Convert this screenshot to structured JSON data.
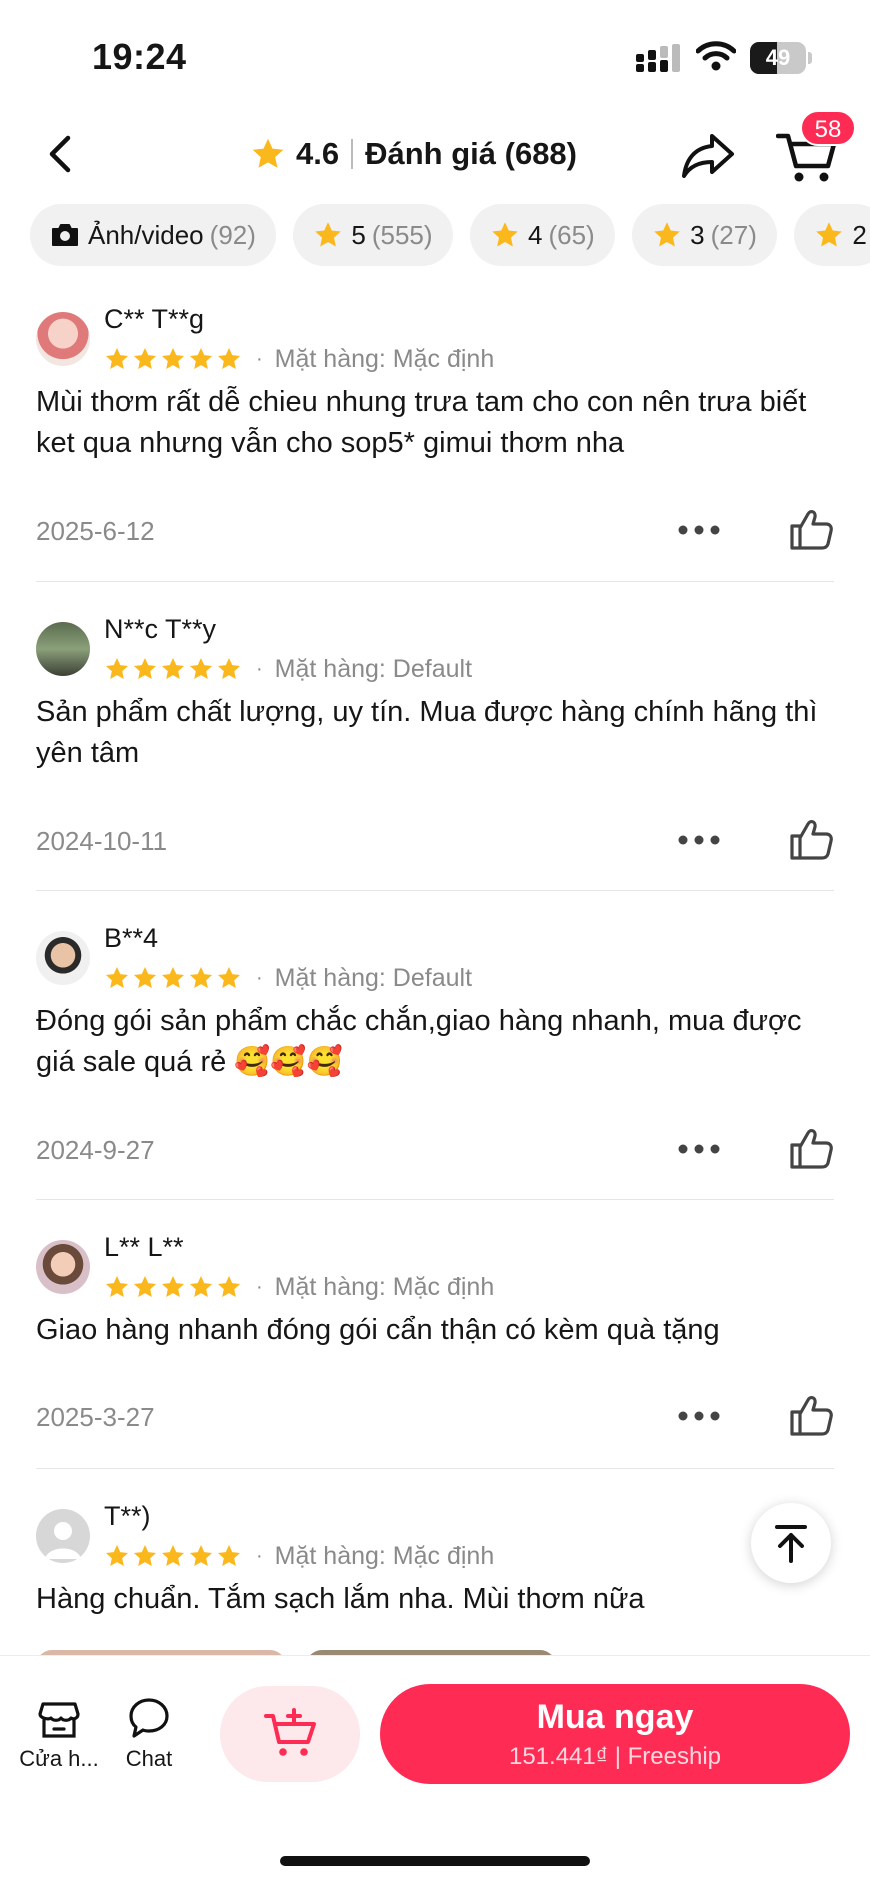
{
  "status_bar": {
    "time": "19:24",
    "battery": "49",
    "battery_level": 0.49
  },
  "header": {
    "rating": "4.6",
    "title": "Đánh giá (688)",
    "cart_badge": "58"
  },
  "filters": [
    {
      "label": "Ảnh/video",
      "count": "(92)",
      "icon": "camera-icon"
    },
    {
      "label": "5",
      "count": "(555)",
      "icon": "star-icon"
    },
    {
      "label": "4",
      "count": "(65)",
      "icon": "star-icon"
    },
    {
      "label": "3",
      "count": "(27)",
      "icon": "star-icon"
    },
    {
      "label": "2",
      "count": "",
      "icon": "star-icon"
    }
  ],
  "reviews": [
    {
      "name": "C** T**g",
      "stars": 5,
      "variant": "Mặt hàng: Mặc định",
      "text": "Mùi thơm rất dễ chieu nhung trưa tam cho con nên trưa biết ket qua nhưng vẫn cho sop5* gimui thơm nha",
      "date": "2025-6-12"
    },
    {
      "name": "N**c T**y",
      "stars": 5,
      "variant": "Mặt hàng: Default",
      "text": "Sản phẩm chất lượng, uy tín. Mua được hàng chính hãng thì yên tâm",
      "date": "2024-10-11"
    },
    {
      "name": "B**4",
      "stars": 5,
      "variant": "Mặt hàng: Default",
      "text": "Đóng gói sản phẩm chắc chắn,giao hàng nhanh, mua được giá sale quá rẻ 🥰🥰🥰",
      "date": "2024-9-27"
    },
    {
      "name": "L** L**",
      "stars": 5,
      "variant": "Mặt hàng: Mặc định",
      "text": "Giao hàng nhanh đóng gói cẩn thận có kèm quà tặng",
      "date": "2025-3-27"
    },
    {
      "name": "T**)",
      "stars": 5,
      "variant": "Mặt hàng: Mặc định",
      "text": "Hàng chuẩn. Tắm sạch lắm nha. Mùi thơm nữa",
      "date": ""
    }
  ],
  "bottom_bar": {
    "shop_label": "Cửa h...",
    "chat_label": "Chat",
    "buy_label": "Mua ngay",
    "buy_sub": "151.441₫ | Freeship"
  },
  "colors": {
    "accent": "#fe2c55",
    "star": "#fbb81c",
    "muted": "#8a8a8a"
  }
}
